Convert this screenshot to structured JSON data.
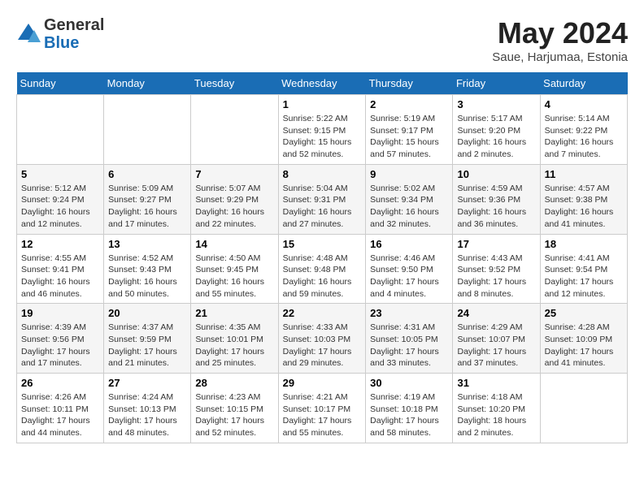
{
  "header": {
    "logo_general": "General",
    "logo_blue": "Blue",
    "month_title": "May 2024",
    "location": "Saue, Harjumaa, Estonia"
  },
  "weekdays": [
    "Sunday",
    "Monday",
    "Tuesday",
    "Wednesday",
    "Thursday",
    "Friday",
    "Saturday"
  ],
  "weeks": [
    [
      {
        "day": "",
        "info": ""
      },
      {
        "day": "",
        "info": ""
      },
      {
        "day": "",
        "info": ""
      },
      {
        "day": "1",
        "info": "Sunrise: 5:22 AM\nSunset: 9:15 PM\nDaylight: 15 hours\nand 52 minutes."
      },
      {
        "day": "2",
        "info": "Sunrise: 5:19 AM\nSunset: 9:17 PM\nDaylight: 15 hours\nand 57 minutes."
      },
      {
        "day": "3",
        "info": "Sunrise: 5:17 AM\nSunset: 9:20 PM\nDaylight: 16 hours\nand 2 minutes."
      },
      {
        "day": "4",
        "info": "Sunrise: 5:14 AM\nSunset: 9:22 PM\nDaylight: 16 hours\nand 7 minutes."
      }
    ],
    [
      {
        "day": "5",
        "info": "Sunrise: 5:12 AM\nSunset: 9:24 PM\nDaylight: 16 hours\nand 12 minutes."
      },
      {
        "day": "6",
        "info": "Sunrise: 5:09 AM\nSunset: 9:27 PM\nDaylight: 16 hours\nand 17 minutes."
      },
      {
        "day": "7",
        "info": "Sunrise: 5:07 AM\nSunset: 9:29 PM\nDaylight: 16 hours\nand 22 minutes."
      },
      {
        "day": "8",
        "info": "Sunrise: 5:04 AM\nSunset: 9:31 PM\nDaylight: 16 hours\nand 27 minutes."
      },
      {
        "day": "9",
        "info": "Sunrise: 5:02 AM\nSunset: 9:34 PM\nDaylight: 16 hours\nand 32 minutes."
      },
      {
        "day": "10",
        "info": "Sunrise: 4:59 AM\nSunset: 9:36 PM\nDaylight: 16 hours\nand 36 minutes."
      },
      {
        "day": "11",
        "info": "Sunrise: 4:57 AM\nSunset: 9:38 PM\nDaylight: 16 hours\nand 41 minutes."
      }
    ],
    [
      {
        "day": "12",
        "info": "Sunrise: 4:55 AM\nSunset: 9:41 PM\nDaylight: 16 hours\nand 46 minutes."
      },
      {
        "day": "13",
        "info": "Sunrise: 4:52 AM\nSunset: 9:43 PM\nDaylight: 16 hours\nand 50 minutes."
      },
      {
        "day": "14",
        "info": "Sunrise: 4:50 AM\nSunset: 9:45 PM\nDaylight: 16 hours\nand 55 minutes."
      },
      {
        "day": "15",
        "info": "Sunrise: 4:48 AM\nSunset: 9:48 PM\nDaylight: 16 hours\nand 59 minutes."
      },
      {
        "day": "16",
        "info": "Sunrise: 4:46 AM\nSunset: 9:50 PM\nDaylight: 17 hours\nand 4 minutes."
      },
      {
        "day": "17",
        "info": "Sunrise: 4:43 AM\nSunset: 9:52 PM\nDaylight: 17 hours\nand 8 minutes."
      },
      {
        "day": "18",
        "info": "Sunrise: 4:41 AM\nSunset: 9:54 PM\nDaylight: 17 hours\nand 12 minutes."
      }
    ],
    [
      {
        "day": "19",
        "info": "Sunrise: 4:39 AM\nSunset: 9:56 PM\nDaylight: 17 hours\nand 17 minutes."
      },
      {
        "day": "20",
        "info": "Sunrise: 4:37 AM\nSunset: 9:59 PM\nDaylight: 17 hours\nand 21 minutes."
      },
      {
        "day": "21",
        "info": "Sunrise: 4:35 AM\nSunset: 10:01 PM\nDaylight: 17 hours\nand 25 minutes."
      },
      {
        "day": "22",
        "info": "Sunrise: 4:33 AM\nSunset: 10:03 PM\nDaylight: 17 hours\nand 29 minutes."
      },
      {
        "day": "23",
        "info": "Sunrise: 4:31 AM\nSunset: 10:05 PM\nDaylight: 17 hours\nand 33 minutes."
      },
      {
        "day": "24",
        "info": "Sunrise: 4:29 AM\nSunset: 10:07 PM\nDaylight: 17 hours\nand 37 minutes."
      },
      {
        "day": "25",
        "info": "Sunrise: 4:28 AM\nSunset: 10:09 PM\nDaylight: 17 hours\nand 41 minutes."
      }
    ],
    [
      {
        "day": "26",
        "info": "Sunrise: 4:26 AM\nSunset: 10:11 PM\nDaylight: 17 hours\nand 44 minutes."
      },
      {
        "day": "27",
        "info": "Sunrise: 4:24 AM\nSunset: 10:13 PM\nDaylight: 17 hours\nand 48 minutes."
      },
      {
        "day": "28",
        "info": "Sunrise: 4:23 AM\nSunset: 10:15 PM\nDaylight: 17 hours\nand 52 minutes."
      },
      {
        "day": "29",
        "info": "Sunrise: 4:21 AM\nSunset: 10:17 PM\nDaylight: 17 hours\nand 55 minutes."
      },
      {
        "day": "30",
        "info": "Sunrise: 4:19 AM\nSunset: 10:18 PM\nDaylight: 17 hours\nand 58 minutes."
      },
      {
        "day": "31",
        "info": "Sunrise: 4:18 AM\nSunset: 10:20 PM\nDaylight: 18 hours\nand 2 minutes."
      },
      {
        "day": "",
        "info": ""
      }
    ]
  ]
}
